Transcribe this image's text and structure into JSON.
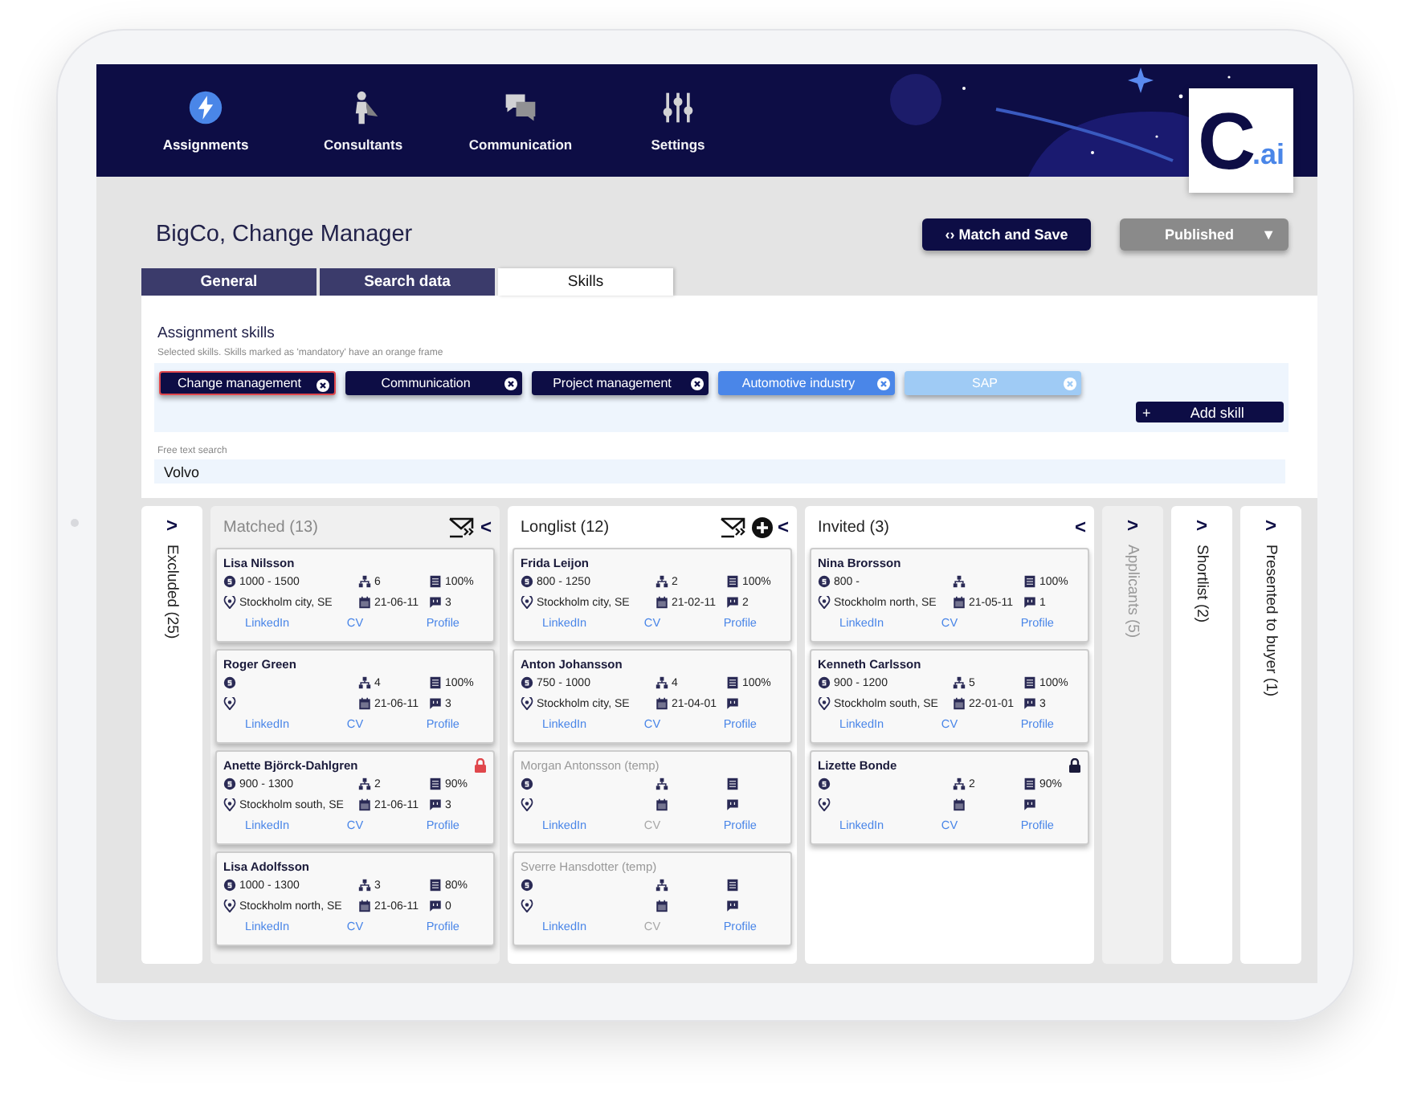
{
  "nav": [
    {
      "kind": "bolt",
      "label": "Assignments",
      "selected": true
    },
    {
      "kind": "person",
      "label": "Consultants",
      "selected": false
    },
    {
      "kind": "chat",
      "label": "Communication",
      "selected": false
    },
    {
      "kind": "sliders",
      "label": "Settings",
      "selected": false
    }
  ],
  "logo": {
    "letter": "C",
    "suffix": ".ai"
  },
  "title": "BigCo, Change Manager",
  "match_button": {
    "icon": "‹›",
    "label": "Match and Save"
  },
  "status_button": {
    "label": "Published",
    "caret": "▼"
  },
  "tabs": [
    {
      "label": "General",
      "selected": false
    },
    {
      "label": "Search data",
      "selected": false
    },
    {
      "label": "Skills",
      "selected": true
    }
  ],
  "skills": {
    "heading": "Assignment skills",
    "note": "Selected skills. Skills marked as 'mandatory' have an orange frame",
    "chips": [
      {
        "label": "Change management",
        "mandatory": true,
        "color": "#0d0d45"
      },
      {
        "label": "Communication",
        "mandatory": false,
        "color": "#0d0d45"
      },
      {
        "label": "Project management",
        "mandatory": false,
        "color": "#0d0d45"
      },
      {
        "label": "Automotive industry",
        "mandatory": false,
        "color": "#4a86e8"
      },
      {
        "label": "SAP",
        "mandatory": false,
        "color": "#9fcbf5"
      }
    ],
    "add_button": {
      "icon": "+",
      "label": "Add skill"
    }
  },
  "search": {
    "label": "Free text search",
    "value": "Volvo"
  },
  "columns": [
    {
      "kind": "collapsed",
      "label": "Excluded (25)",
      "toggle": ">",
      "dimmed": false
    },
    {
      "kind": "expanded",
      "label": "Matched (13)",
      "toggle": "<",
      "dimmed": true,
      "mail_button": true,
      "add_button": false,
      "cards": [
        {
          "name": "Lisa Nilsson",
          "temp": false,
          "rate": "1000 - 1500",
          "rank": "6",
          "match": "100%",
          "location": "Stockholm city, SE",
          "date": "21-06-11",
          "messages": "3",
          "links": [
            {
              "label": "LinkedIn",
              "disabled": false
            },
            {
              "label": "CV",
              "disabled": false
            },
            {
              "label": "Profile",
              "disabled": false
            }
          ]
        },
        {
          "name": "Roger Green",
          "temp": false,
          "rank": "4",
          "match": "100%",
          "date": "21-06-11",
          "messages": "3",
          "links": [
            {
              "label": "LinkedIn",
              "disabled": false
            },
            {
              "label": "CV",
              "disabled": false
            },
            {
              "label": "Profile",
              "disabled": false
            }
          ]
        },
        {
          "name": "Anette Björck-Dahlgren",
          "temp": false,
          "lock": {
            "color": "#e0474c"
          },
          "rate": "900 - 1300",
          "rank": "2",
          "match": "90%",
          "location": "Stockholm south, SE",
          "date": "21-06-11",
          "messages": "3",
          "links": [
            {
              "label": "LinkedIn",
              "disabled": false
            },
            {
              "label": "CV",
              "disabled": false
            },
            {
              "label": "Profile",
              "disabled": false
            }
          ]
        },
        {
          "name": "Lisa Adolfsson",
          "temp": false,
          "rate": "1000 - 1300",
          "rank": "3",
          "match": "80%",
          "location": "Stockholm north, SE",
          "date": "21-06-11",
          "messages": "0",
          "links": [
            {
              "label": "LinkedIn",
              "disabled": false
            },
            {
              "label": "CV",
              "disabled": false
            },
            {
              "label": "Profile",
              "disabled": false
            }
          ]
        }
      ]
    },
    {
      "kind": "expanded",
      "label": "Longlist (12)",
      "toggle": "<",
      "dimmed": false,
      "mail_button": true,
      "add_button": true,
      "cards": [
        {
          "name": "Frida Leijon",
          "temp": false,
          "rate": "800 - 1250",
          "rank": "2",
          "match": "100%",
          "location": "Stockholm city, SE",
          "date": "21-02-11",
          "messages": "2",
          "links": [
            {
              "label": "LinkedIn",
              "disabled": false
            },
            {
              "label": "CV",
              "disabled": false
            },
            {
              "label": "Profile",
              "disabled": false
            }
          ]
        },
        {
          "name": "Anton Johansson",
          "temp": false,
          "rate": "750 - 1000",
          "rank": "4",
          "match": "100%",
          "location": "Stockholm city, SE",
          "date": "21-04-01",
          "links": [
            {
              "label": "LinkedIn",
              "disabled": false
            },
            {
              "label": "CV",
              "disabled": false
            },
            {
              "label": "Profile",
              "disabled": false
            }
          ]
        },
        {
          "name": "Morgan Antonsson (temp)",
          "temp": true,
          "links": [
            {
              "label": "LinkedIn",
              "disabled": false
            },
            {
              "label": "CV",
              "disabled": true
            },
            {
              "label": "Profile",
              "disabled": false
            }
          ]
        },
        {
          "name": "Sverre Hansdotter (temp)",
          "temp": true,
          "links": [
            {
              "label": "LinkedIn",
              "disabled": false
            },
            {
              "label": "CV",
              "disabled": true
            },
            {
              "label": "Profile",
              "disabled": false
            }
          ]
        }
      ]
    },
    {
      "kind": "expanded",
      "label": "Invited (3)",
      "toggle": "<",
      "dimmed": false,
      "mail_button": false,
      "add_button": false,
      "cards": [
        {
          "name": "Nina Brorsson",
          "temp": false,
          "rate": "800 -",
          "match": "100%",
          "location": "Stockholm north, SE",
          "date": "21-05-11",
          "messages": "1",
          "links": [
            {
              "label": "LinkedIn",
              "disabled": false
            },
            {
              "label": "CV",
              "disabled": false
            },
            {
              "label": "Profile",
              "disabled": false
            }
          ]
        },
        {
          "name": "Kenneth Carlsson",
          "temp": false,
          "rate": "900 - 1200",
          "rank": "5",
          "match": "100%",
          "location": "Stockholm south, SE",
          "date": "22-01-01",
          "messages": "3",
          "links": [
            {
              "label": "LinkedIn",
              "disabled": false
            },
            {
              "label": "CV",
              "disabled": false
            },
            {
              "label": "Profile",
              "disabled": false
            }
          ]
        },
        {
          "name": "Lizette Bonde",
          "temp": false,
          "lock": {
            "color": "#1a1a3a"
          },
          "rank": "2",
          "match": "90%",
          "links": [
            {
              "label": "LinkedIn",
              "disabled": false
            },
            {
              "label": "CV",
              "disabled": false
            },
            {
              "label": "Profile",
              "disabled": false
            }
          ]
        }
      ]
    },
    {
      "kind": "collapsed",
      "label": "Applicants (5)",
      "toggle": ">",
      "dimmed": true
    },
    {
      "kind": "collapsed",
      "label": "Shortlist (2)",
      "toggle": ">",
      "dimmed": false
    },
    {
      "kind": "collapsed",
      "label": "Presented to buyer (1)",
      "toggle": ">",
      "dimmed": false
    }
  ]
}
